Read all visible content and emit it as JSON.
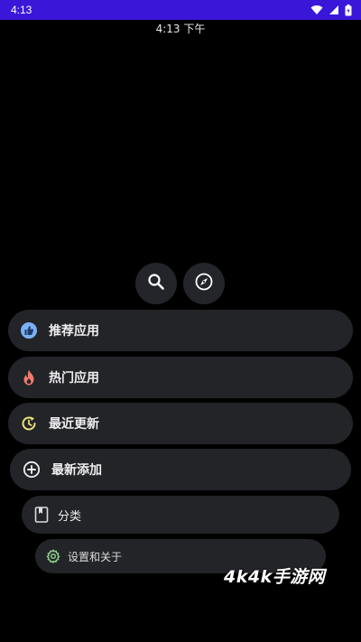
{
  "status_bar": {
    "time": "4:13",
    "icons": [
      "wifi-icon",
      "signal-icon",
      "battery-icon"
    ]
  },
  "clock": {
    "text": "4:13 下午"
  },
  "top_buttons": [
    {
      "icon": "search-icon"
    },
    {
      "icon": "compass-icon"
    }
  ],
  "menu": {
    "items": [
      {
        "label": "推荐应用",
        "icon": "thumbs-up-icon",
        "icon_color": "#7ab0f5"
      },
      {
        "label": "热门应用",
        "icon": "fire-icon",
        "icon_color": "#f07a6a"
      },
      {
        "label": "最近更新",
        "icon": "refresh-clock-icon",
        "icon_color": "#e9e27a"
      },
      {
        "label": "最新添加",
        "icon": "add-circle-icon",
        "icon_color": "#eeeeee"
      },
      {
        "label": "分类",
        "icon": "book-icon",
        "icon_color": "#dddddd"
      },
      {
        "label": "设置和关于",
        "icon": "gear-icon",
        "icon_color": "#8fcf8a"
      }
    ]
  },
  "watermark": {
    "text": "4k4k手游网"
  },
  "colors": {
    "status_bar": "#3a16d9",
    "background": "#000000",
    "pill": "#232428"
  }
}
